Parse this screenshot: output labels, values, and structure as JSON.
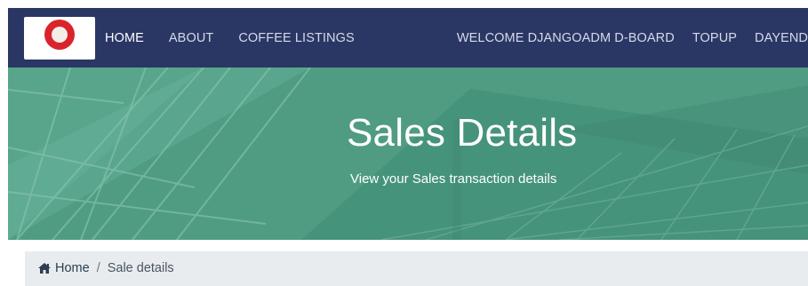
{
  "nav": {
    "left_links": [
      "HOME",
      "ABOUT",
      "COFFEE LISTINGS"
    ],
    "right_links": [
      "WELCOME DJANGOADM D-BOARD",
      "TOPUP",
      "DAYEND"
    ]
  },
  "hero": {
    "title": "Sales Details",
    "subtitle": "View your Sales transaction details"
  },
  "breadcrumb": {
    "home": "Home",
    "separator": "/",
    "current": "Sale details"
  },
  "colors": {
    "navbar": "#2a3764",
    "hero": "#4f9c83",
    "breadcrumb_bg": "#e9ecef"
  },
  "icons": [
    "home-icon",
    "brand-logo"
  ]
}
